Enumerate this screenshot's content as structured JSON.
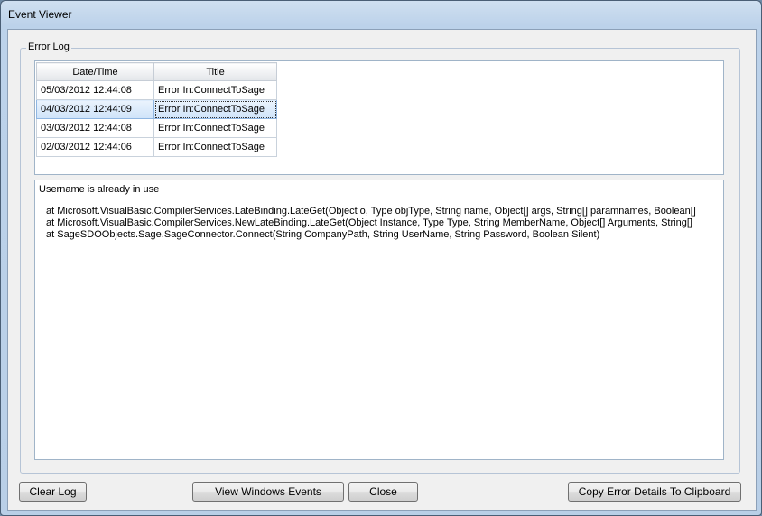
{
  "window": {
    "title": "Event Viewer"
  },
  "error_log": {
    "group_title": "Error Log",
    "columns": [
      "Date/Time",
      "Title"
    ],
    "rows": [
      {
        "datetime": "05/03/2012 12:44:08",
        "title": "Error In:ConnectToSage",
        "selected": false
      },
      {
        "datetime": "04/03/2012 12:44:09",
        "title": "Error In:ConnectToSage",
        "selected": true
      },
      {
        "datetime": "03/03/2012 12:44:08",
        "title": "Error In:ConnectToSage",
        "selected": false
      },
      {
        "datetime": "02/03/2012 12:44:06",
        "title": "Error In:ConnectToSage",
        "selected": false
      }
    ],
    "detail_message": "Username is already in use",
    "stack_trace": [
      "at Microsoft.VisualBasic.CompilerServices.LateBinding.LateGet(Object o, Type objType, String name, Object[] args, String[] paramnames, Boolean[]",
      "at Microsoft.VisualBasic.CompilerServices.NewLateBinding.LateGet(Object Instance, Type Type, String MemberName, Object[] Arguments, String[]",
      "at SageSDOObjects.Sage.SageConnector.Connect(String CompanyPath, String UserName, String Password, Boolean Silent)"
    ]
  },
  "buttons": {
    "clear_log": "Clear Log",
    "view_windows_events": "View Windows Events",
    "close": "Close",
    "copy_error_details": "Copy Error Details To Clipboard"
  }
}
